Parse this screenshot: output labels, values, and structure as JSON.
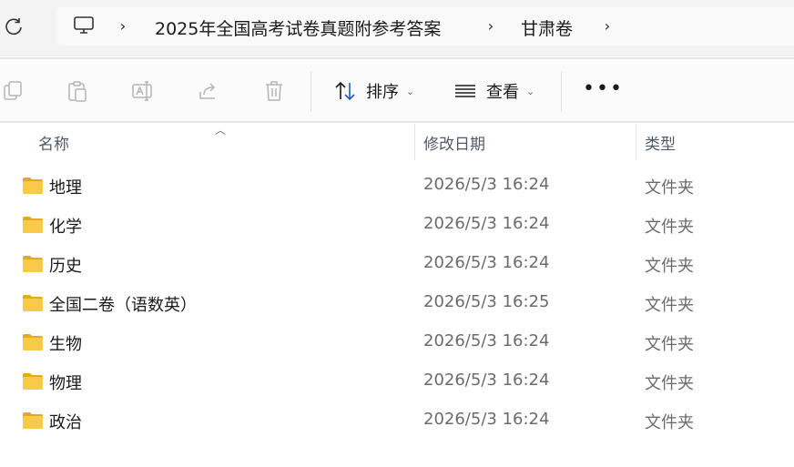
{
  "address_bar": {
    "breadcrumbs": [
      "2025年全国高考试卷真题附参考答案",
      "甘肃卷"
    ]
  },
  "command_bar": {
    "sort_label": "排序",
    "view_label": "查看",
    "more_label": "•••"
  },
  "columns": {
    "name": "名称",
    "modified": "修改日期",
    "type": "类型"
  },
  "files": [
    {
      "name": "地理",
      "modified": "2026/5/3 16:24",
      "type": "文件夹"
    },
    {
      "name": "化学",
      "modified": "2026/5/3 16:24",
      "type": "文件夹"
    },
    {
      "name": "历史",
      "modified": "2026/5/3 16:24",
      "type": "文件夹"
    },
    {
      "name": "全国二卷（语数英）",
      "modified": "2026/5/3 16:25",
      "type": "文件夹"
    },
    {
      "name": "生物",
      "modified": "2026/5/3 16:24",
      "type": "文件夹"
    },
    {
      "name": "物理",
      "modified": "2026/5/3 16:24",
      "type": "文件夹"
    },
    {
      "name": "政治",
      "modified": "2026/5/3 16:24",
      "type": "文件夹"
    }
  ],
  "colors": {
    "folder_front": "#f8ca4a",
    "folder_back": "#e5a823",
    "secondary_text": "#6b6b6b"
  }
}
